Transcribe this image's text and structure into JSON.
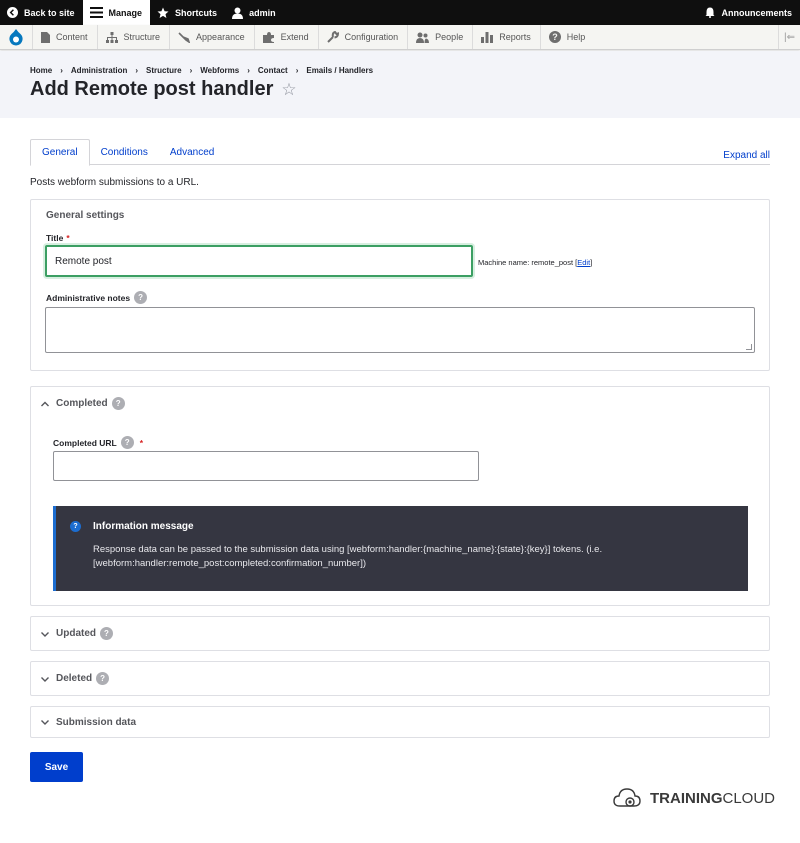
{
  "toolbar": {
    "back_label": "Back to site",
    "manage_label": "Manage",
    "shortcuts_label": "Shortcuts",
    "user_label": "admin",
    "announcements_label": "Announcements"
  },
  "tray": {
    "items": [
      "Content",
      "Structure",
      "Appearance",
      "Extend",
      "Configuration",
      "People",
      "Reports",
      "Help"
    ]
  },
  "breadcrumb": [
    "Home",
    "Administration",
    "Structure",
    "Webforms",
    "Contact",
    "Emails / Handlers"
  ],
  "page_title": "Add Remote post handler",
  "tabs": [
    "General",
    "Conditions",
    "Advanced"
  ],
  "expand_all": "Expand all",
  "description": "Posts webform submissions to a URL.",
  "general": {
    "legend": "General settings",
    "title_label": "Title",
    "title_value": "Remote post",
    "machine_prefix": "Machine name: remote_post ",
    "machine_edit": "Edit",
    "notes_label": "Administrative notes"
  },
  "completed": {
    "label": "Completed",
    "url_label": "Completed URL",
    "info_title": "Information message",
    "info_body": "Response data can be passed to the submission data using [webform:handler:{machine_name}:{state}:{key}] tokens. (i.e. [webform:handler:remote_post:completed:confirmation_number])"
  },
  "sections": [
    "Updated",
    "Deleted",
    "Submission data"
  ],
  "save_label": "Save",
  "brand": {
    "part1": "TRAINING",
    "part2": "CLOUD"
  }
}
